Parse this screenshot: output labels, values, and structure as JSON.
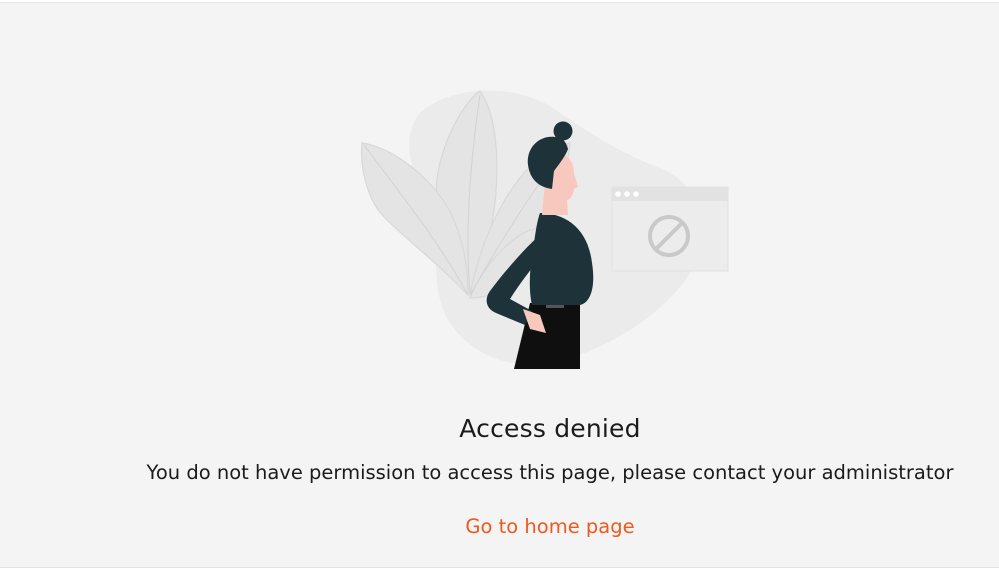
{
  "error": {
    "title": "Access denied",
    "message": "You do not have permission to access this page, please contact your administrator",
    "home_link_label": "Go to home page"
  },
  "colors": {
    "background": "#f4f4f4",
    "text": "#1b1b1b",
    "link": "#f0591e",
    "figure_dark": "#1e3239",
    "skin": "#f7c9be",
    "illustration_gray": "#e6e6e6"
  },
  "icons": {
    "illustration": "woman-with-blocked-window-illustration",
    "blocked": "prohibited-icon"
  }
}
